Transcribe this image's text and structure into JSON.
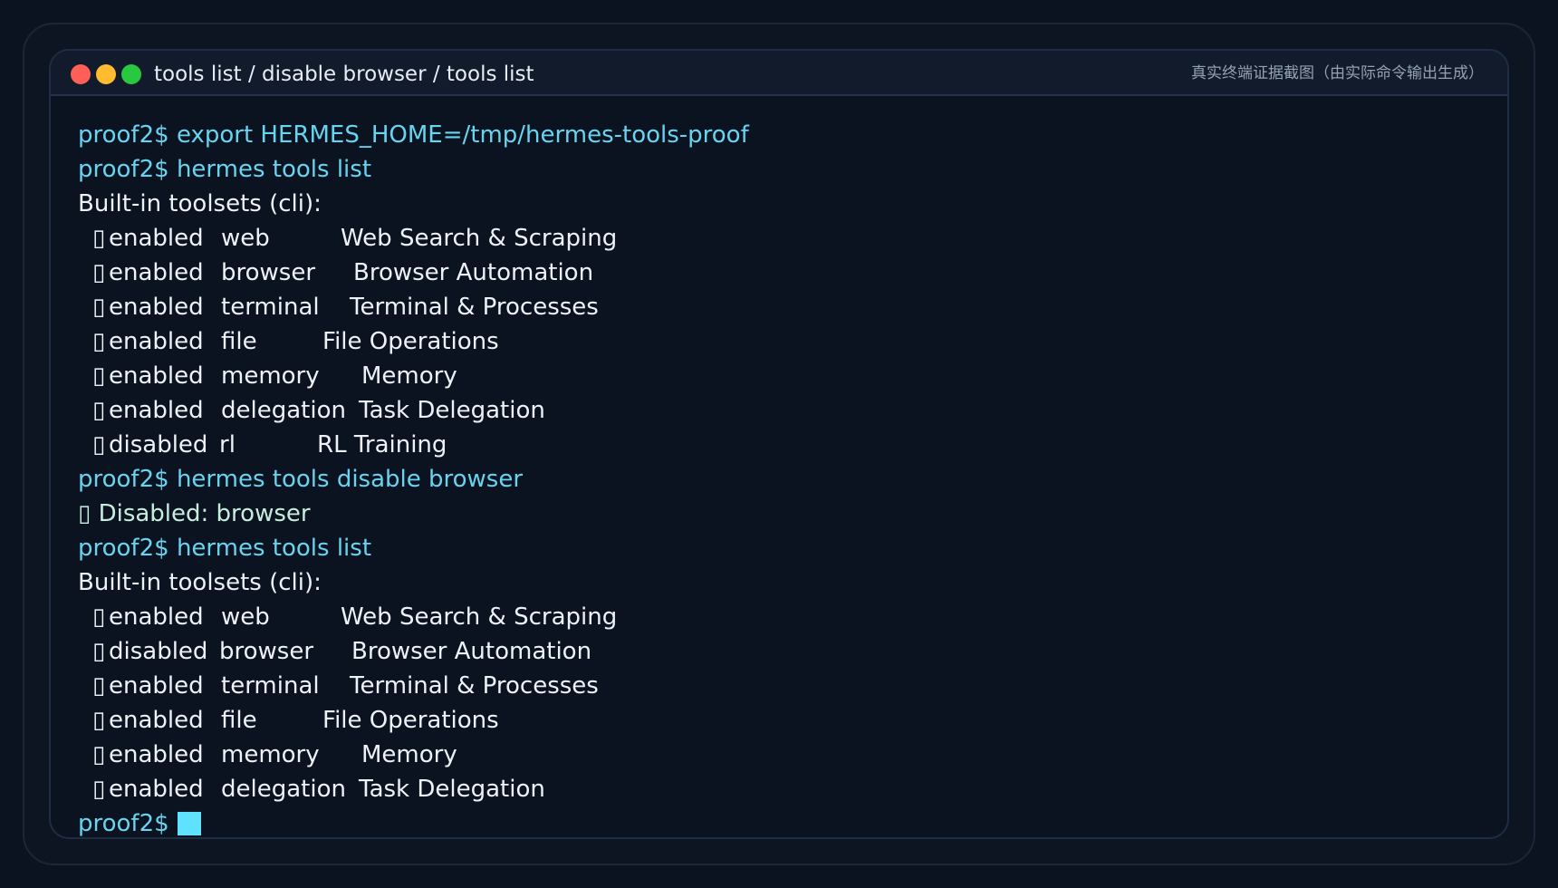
{
  "window": {
    "title": "tools list / disable browser / tools list",
    "badge": "真实终端证据截图（由实际命令输出生成）"
  },
  "terminal": {
    "prompt": "proof2$",
    "commands": {
      "export": "proof2$ export HERMES_HOME=/tmp/hermes-tools-proof",
      "list1": "proof2$ hermes tools list",
      "disable": "proof2$ hermes tools disable browser",
      "list2": "proof2$ hermes tools list"
    },
    "header": "Built-in toolsets (cli):",
    "disabled_msg": "▯ Disabled: browser",
    "list1": [
      {
        "glyph": "▯",
        "state": "enabled",
        "name": "web",
        "desc": "Web Search & Scraping"
      },
      {
        "glyph": "▯",
        "state": "enabled",
        "name": "browser",
        "desc": "Browser Automation"
      },
      {
        "glyph": "▯",
        "state": "enabled",
        "name": "terminal",
        "desc": "Terminal & Processes"
      },
      {
        "glyph": "▯",
        "state": "enabled",
        "name": "file",
        "desc": "File Operations"
      },
      {
        "glyph": "▯",
        "state": "enabled",
        "name": "memory",
        "desc": "Memory"
      },
      {
        "glyph": "▯",
        "state": "enabled",
        "name": "delegation",
        "desc": "Task Delegation"
      },
      {
        "glyph": "▯",
        "state": "disabled",
        "name": "rl",
        "desc": "RL Training"
      }
    ],
    "list2": [
      {
        "glyph": "▯",
        "state": "enabled",
        "name": "web",
        "desc": "Web Search & Scraping"
      },
      {
        "glyph": "▯",
        "state": "disabled",
        "name": "browser",
        "desc": "Browser Automation"
      },
      {
        "glyph": "▯",
        "state": "enabled",
        "name": "terminal",
        "desc": "Terminal & Processes"
      },
      {
        "glyph": "▯",
        "state": "enabled",
        "name": "file",
        "desc": "File Operations"
      },
      {
        "glyph": "▯",
        "state": "enabled",
        "name": "memory",
        "desc": "Memory"
      },
      {
        "glyph": "▯",
        "state": "enabled",
        "name": "delegation",
        "desc": "Task Delegation"
      }
    ]
  },
  "colors": {
    "background": "#0c1320",
    "command": "#67d4f0",
    "output": "#eef2f7",
    "cursor": "#5fe2ff",
    "dot_close": "#ff5f57",
    "dot_minimize": "#febc2e",
    "dot_zoom": "#28c840"
  }
}
